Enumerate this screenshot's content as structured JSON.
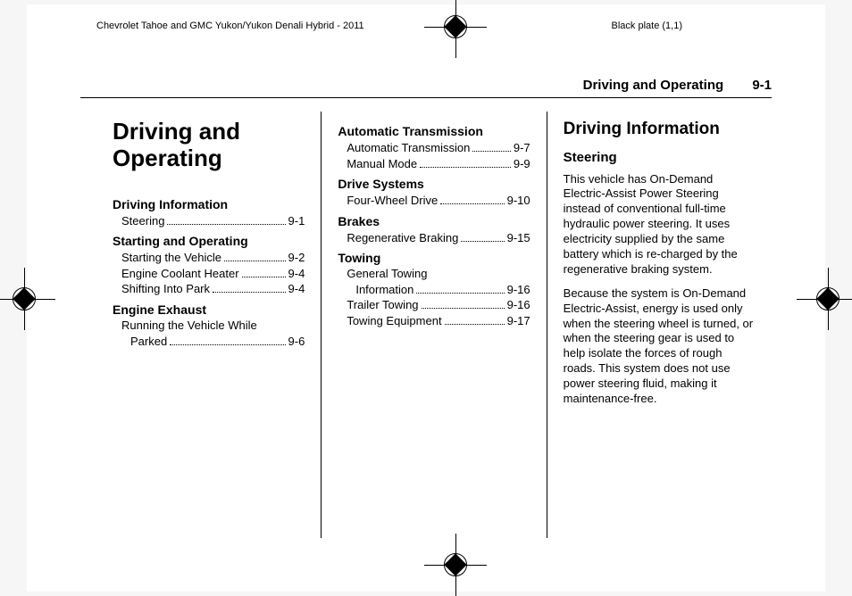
{
  "header": {
    "left": "Chevrolet Tahoe and GMC Yukon/Yukon Denali Hybrid - 2011",
    "right": "Black plate (1,1)"
  },
  "running": {
    "section": "Driving and Operating",
    "page": "9-1"
  },
  "chapterTitle": "Driving and Operating",
  "toc1": [
    {
      "head": "Driving Information",
      "items": [
        {
          "label": "Steering",
          "page": "9-1"
        }
      ]
    },
    {
      "head": "Starting and Operating",
      "items": [
        {
          "label": "Starting the Vehicle",
          "page": "9-2"
        },
        {
          "label": "Engine Coolant Heater",
          "page": "9-4"
        },
        {
          "label": "Shifting Into Park",
          "page": "9-4"
        }
      ]
    },
    {
      "head": "Engine Exhaust",
      "items": [
        {
          "label": "Running the Vehicle While Parked",
          "page": "9-6",
          "wrap": true
        }
      ]
    }
  ],
  "toc2": [
    {
      "head": "Automatic Transmission",
      "items": [
        {
          "label": "Automatic Transmission",
          "page": "9-7"
        },
        {
          "label": "Manual Mode",
          "page": "9-9"
        }
      ]
    },
    {
      "head": "Drive Systems",
      "items": [
        {
          "label": "Four-Wheel Drive",
          "page": "9-10"
        }
      ]
    },
    {
      "head": "Brakes",
      "items": [
        {
          "label": "Regenerative Braking",
          "page": "9-15"
        }
      ]
    },
    {
      "head": "Towing",
      "items": [
        {
          "label": "General Towing Information",
          "page": "9-16",
          "wrap": true
        },
        {
          "label": "Trailer Towing",
          "page": "9-16"
        },
        {
          "label": "Towing Equipment",
          "page": "9-17"
        }
      ]
    }
  ],
  "body": {
    "h2": "Driving Information",
    "h3": "Steering",
    "p1": "This vehicle has On-Demand Electric-Assist Power Steering instead of conventional full-time hydraulic power steering. It uses electricity supplied by the same battery which is re-charged by the regenerative braking system.",
    "p2": "Because the system is On-Demand Electric-Assist, energy is used only when the steering wheel is turned, or when the steering gear is used to help isolate the forces of rough roads. This system does not use power steering fluid, making it maintenance-free."
  }
}
